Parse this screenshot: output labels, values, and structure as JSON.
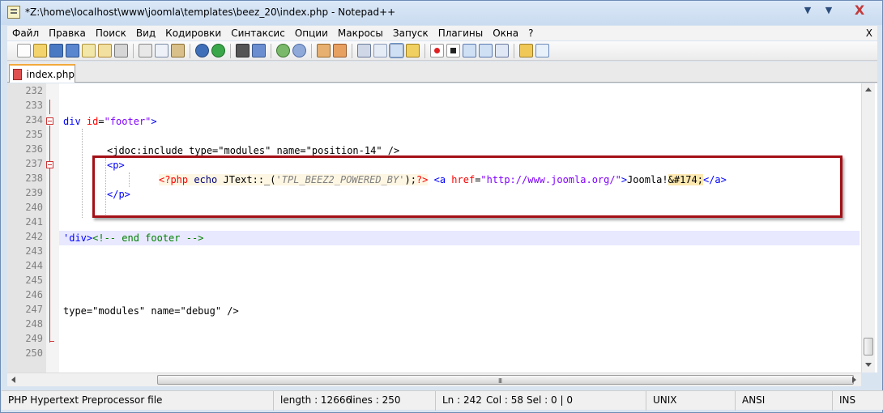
{
  "window": {
    "title": "*Z:\\home\\localhost\\www\\joomla\\templates\\beez_20\\index.php - Notepad++",
    "close_glyph": "X",
    "min_glyph": "▼",
    "max_glyph": "▼"
  },
  "menu": {
    "items": [
      "Файл",
      "Правка",
      "Поиск",
      "Вид",
      "Кодировки",
      "Синтаксис",
      "Опции",
      "Макросы",
      "Запуск",
      "Плагины",
      "Окна",
      "?"
    ],
    "close_label": "X"
  },
  "toolbar": {
    "icons": [
      "new-file-icon",
      "open-file-icon",
      "save-icon",
      "save-all-icon",
      "close-icon",
      "close-all-icon",
      "print-icon",
      "cut-icon",
      "copy-icon",
      "paste-icon",
      "undo-icon",
      "redo-icon",
      "find-icon",
      "replace-icon",
      "zoom-in-icon",
      "zoom-out-icon",
      "sync-vertical-icon",
      "sync-horizontal-icon",
      "word-wrap-icon",
      "show-all-chars-icon",
      "indent-guide-icon",
      "user-lang-icon",
      "record-macro-icon",
      "stop-macro-icon",
      "play-macro-icon",
      "run-macro-multiple-icon",
      "save-macro-icon",
      "open-folder-icon",
      "spellcheck-icon"
    ]
  },
  "tab": {
    "label": "index.php"
  },
  "editor": {
    "line_numbers": [
      "232",
      "233",
      "234",
      "235",
      "236",
      "237",
      "238",
      "239",
      "240",
      "241",
      "242",
      "243",
      "244",
      "245",
      "246",
      "247",
      "248",
      "249",
      "250"
    ],
    "line234": {
      "tag_open": "div ",
      "attr": "id",
      "eq": "=",
      "val": "\"footer\"",
      "close": ">"
    },
    "line236": {
      "text": "<jdoc:include type=\"modules\" name=\"position-14\" />"
    },
    "line237": {
      "text": "<p>"
    },
    "line238": {
      "php_open": "<?php",
      "echo": " echo ",
      "call": "JText::_(",
      "arg": "'TPL_BEEZ2_POWERED_BY'",
      "call_end": ");",
      "php_close": "?>",
      "a_open": " <a ",
      "href": "href",
      "eq": "=",
      "url": "\"http://www.joomla.org/\"",
      "gt": ">",
      "link_text": "Joomla!",
      "entity": "&#174;",
      "a_close": "</a>"
    },
    "line239": {
      "text": "</p>"
    },
    "line242": {
      "tag": "'div>",
      "comment": "<!-- end footer -->"
    },
    "line247": {
      "text": "type=\"modules\" name=\"debug\" />"
    }
  },
  "statusbar": {
    "file_type": "PHP Hypertext Preprocessor file",
    "length": "length : 12666",
    "lines": "lines : 250",
    "ln": "Ln : 242",
    "col": "Col : 58",
    "sel": "Sel : 0 | 0",
    "eol": "UNIX",
    "encoding": "ANSI",
    "mode": "INS"
  },
  "colors": {
    "annotation_border": "#a40f16",
    "tab_accent": "#f2a93b",
    "tag_blue": "#0000ff",
    "attr_red": "#ff0000",
    "string_purple": "#8000ff",
    "comment_green": "#008000"
  }
}
